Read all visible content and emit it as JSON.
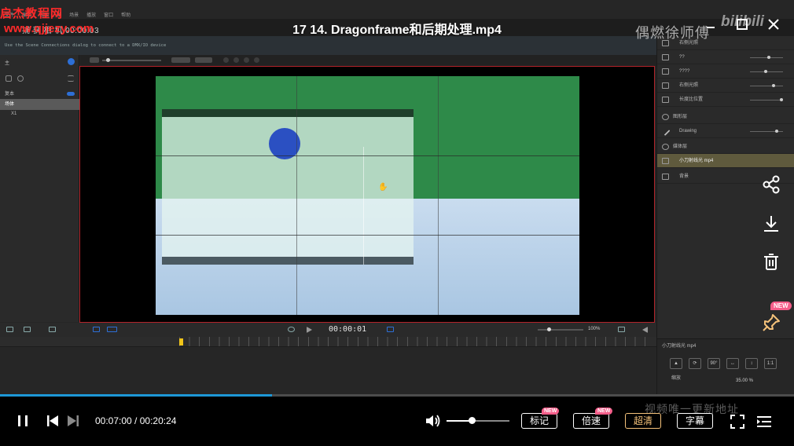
{
  "player": {
    "title": "17 14. Dragonframe和后期处理.mp4",
    "watermark_top": "启杰教程网",
    "watermark_url": "www.qjjezy.com",
    "uploader_mark": "偶燃徐师傅",
    "logo_text": "bilibili",
    "bottom_watermark": "视频唯一更新地址",
    "current_time": "00:07:00",
    "duration": "00:20:24",
    "time_separator": " / ",
    "progress_fraction": 0.343,
    "volume_fraction": 0.4,
    "buttons": {
      "mark": "标记",
      "speed": "倍速",
      "quality": "超清",
      "subtitle": "字幕"
    },
    "badge_new": "NEW",
    "accent_color": "#1e98d7",
    "active_color": "#f5c27a",
    "badge_color": "#f55e8a"
  },
  "app": {
    "subtitle": "捕 获 相 机 00:00:03",
    "hint": "Use the Scene   Connections dialog to connect to a DMX/IO device",
    "menu": [
      "文件",
      "编辑",
      "视图",
      "帧",
      "场景",
      "播放",
      "窗口",
      "帮助"
    ],
    "left_panel": {
      "header": "主",
      "section": "复本",
      "layer_selected": "场体",
      "layer_child": "X1"
    },
    "transport": {
      "timecode": "00:00:01",
      "zoom": "100%"
    },
    "right_panel": {
      "rows": [
        "右侧光照",
        "??",
        "????",
        "右侧光照",
        "长度比位置",
        "图形层",
        "Drawing",
        "媒体层",
        "小刀射线光 mp4",
        "背景"
      ],
      "bottom_label": "小刀射线光 mp4",
      "bottom_buttons": [
        "▲",
        "⟳",
        "90°",
        "↔",
        "↕",
        "1:1"
      ],
      "scale_label": "缩放",
      "scale_value": "35.00 %"
    }
  }
}
